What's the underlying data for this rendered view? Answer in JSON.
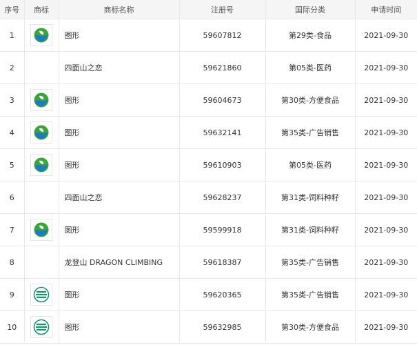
{
  "columns": {
    "index": "序号",
    "logo": "商标",
    "name": "商标名称",
    "reg_no": "注册号",
    "class": "国际分类",
    "date": "申请时间"
  },
  "rows": [
    {
      "index": "1",
      "logo_icon": "green-blue-leaf-icon",
      "name": "图形",
      "reg_no": "59607812",
      "class": "第29类-食品",
      "date": "2021-09-30"
    },
    {
      "index": "2",
      "logo_icon": "",
      "name": "四面山之恋",
      "reg_no": "59621860",
      "class": "第05类-医药",
      "date": "2021-09-30"
    },
    {
      "index": "3",
      "logo_icon": "green-blue-leaf-icon",
      "name": "图形",
      "reg_no": "59604673",
      "class": "第30类-方便食品",
      "date": "2021-09-30"
    },
    {
      "index": "4",
      "logo_icon": "green-blue-leaf-icon",
      "name": "图形",
      "reg_no": "59632141",
      "class": "第35类-广告销售",
      "date": "2021-09-30"
    },
    {
      "index": "5",
      "logo_icon": "green-blue-leaf-icon",
      "name": "图形",
      "reg_no": "59610903",
      "class": "第05类-医药",
      "date": "2021-09-30"
    },
    {
      "index": "6",
      "logo_icon": "",
      "name": "四面山之恋",
      "reg_no": "59628237",
      "class": "第31类-饲料种籽",
      "date": "2021-09-30"
    },
    {
      "index": "7",
      "logo_icon": "green-blue-leaf-icon",
      "name": "图形",
      "reg_no": "59599918",
      "class": "第31类-饲料种籽",
      "date": "2021-09-30"
    },
    {
      "index": "8",
      "logo_icon": "",
      "name": "龙登山 DRAGON CLIMBING",
      "reg_no": "59618387",
      "class": "第35类-广告销售",
      "date": "2021-09-30"
    },
    {
      "index": "9",
      "logo_icon": "green-striped-circle-icon",
      "name": "图形",
      "reg_no": "59620365",
      "class": "第35类-广告销售",
      "date": "2021-09-30"
    },
    {
      "index": "10",
      "logo_icon": "green-striped-circle-icon",
      "name": "图形",
      "reg_no": "59632985",
      "class": "第30类-方便食品",
      "date": "2021-09-30"
    }
  ],
  "colors": {
    "header_bg": "#f5f5f5",
    "border": "#e8e8e8",
    "logo_green": "#3aa53a",
    "logo_blue": "#1f78c8",
    "logo_teal": "#1a8f6b"
  }
}
